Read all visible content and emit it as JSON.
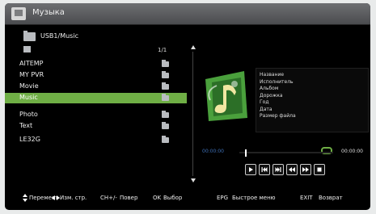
{
  "window": {
    "title": "Музыка"
  },
  "path": {
    "label": "USB1/Music"
  },
  "list": {
    "page": "1/1",
    "items": [
      {
        "label": "AITEMP"
      },
      {
        "label": "MY PVR"
      },
      {
        "label": "Movie"
      },
      {
        "label": "Music"
      },
      {
        "label": "Photo"
      },
      {
        "label": "Text"
      },
      {
        "label": "LE32G"
      }
    ],
    "selected_index": 3
  },
  "player": {
    "meta_lines": [
      "Название",
      "Исполнитель",
      "Альбом",
      "Дорожка",
      "Год",
      "Дата",
      "Размер файла"
    ],
    "current_time": "00:00:00",
    "total_time": "00:00:00",
    "buttons": [
      "play-icon",
      "prev-track-icon",
      "next-track-icon",
      "rewind-icon",
      "fast-forward-icon",
      "stop-icon"
    ]
  },
  "footer": {
    "move": "Перемест",
    "page": "Изм. стр.",
    "ch_key": "CH+/-",
    "ch_label": "Повер",
    "ok_key": "OK",
    "ok_label": "Выбор",
    "epg_key": "EPG",
    "epg_label": "Быстрое меню",
    "exit_key": "EXIT",
    "exit_label": "Возврат"
  },
  "colors": {
    "accent": "#6fae45",
    "time": "#3e6fb5",
    "background": "#000000"
  }
}
